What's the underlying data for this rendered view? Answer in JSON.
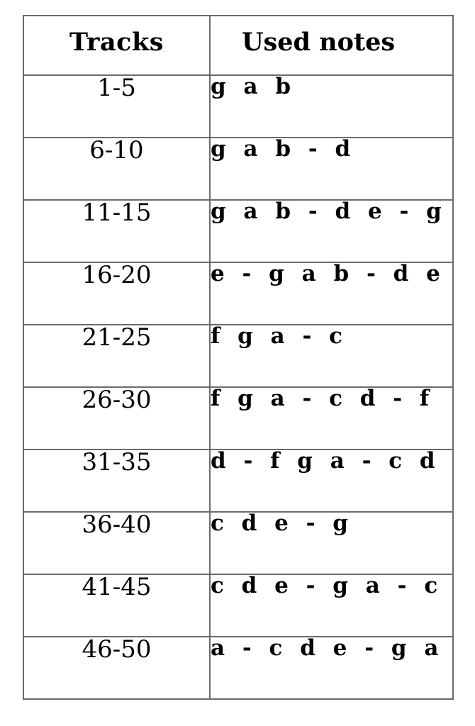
{
  "table": {
    "columns": [
      {
        "key": "tracks",
        "header": "Tracks"
      },
      {
        "key": "used_notes",
        "header": "Used notes"
      }
    ],
    "rows": [
      {
        "tracks": "1-5",
        "used_notes": "g a b"
      },
      {
        "tracks": "6-10",
        "used_notes": "g a b - d"
      },
      {
        "tracks": "11-15",
        "used_notes": "g a b - d e - g"
      },
      {
        "tracks": "16-20",
        "used_notes": "e - g a b - d e"
      },
      {
        "tracks": "21-25",
        "used_notes": "f g a - c"
      },
      {
        "tracks": "26-30",
        "used_notes": "f g a - c d - f"
      },
      {
        "tracks": "31-35",
        "used_notes": "d - f g a - c d"
      },
      {
        "tracks": "36-40",
        "used_notes": "c d e - g"
      },
      {
        "tracks": "41-45",
        "used_notes": "c d e - g a - c"
      },
      {
        "tracks": "46-50",
        "used_notes": "a - c d e - g a"
      }
    ]
  },
  "style": {
    "border_color": "#6b6b6b",
    "text_color": "#000000",
    "background_color": "#ffffff"
  }
}
